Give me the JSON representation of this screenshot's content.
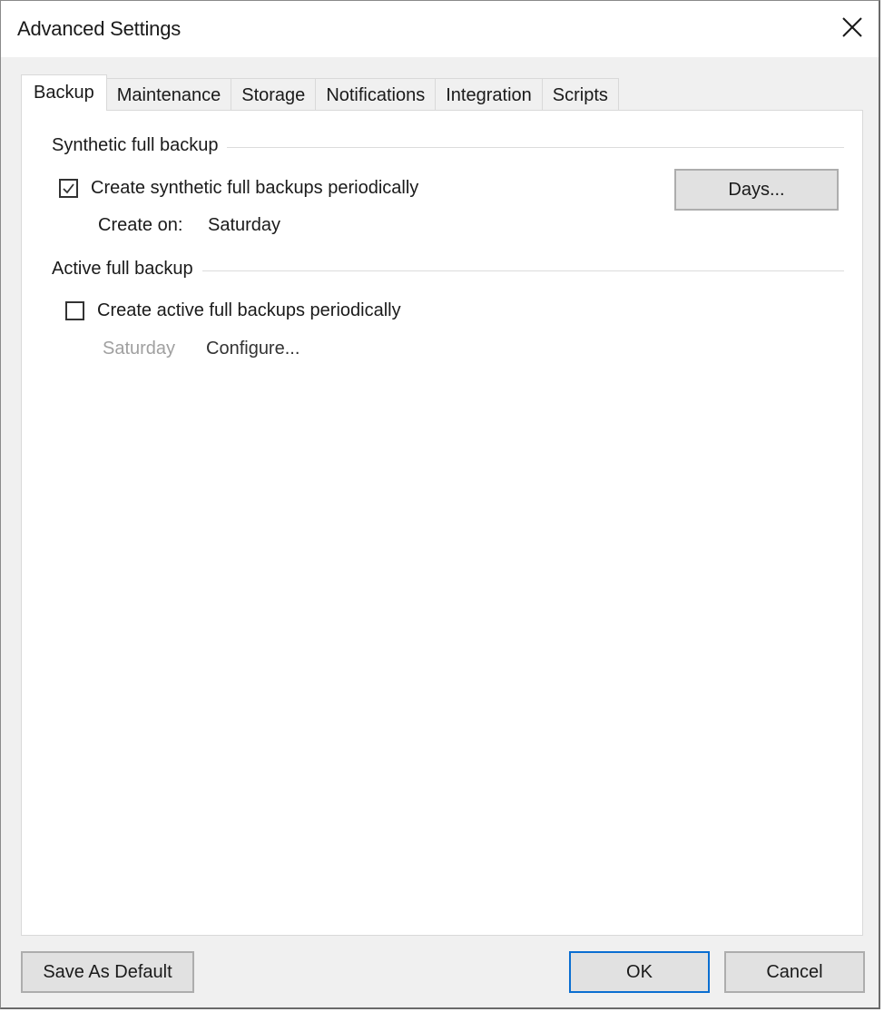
{
  "window": {
    "title": "Advanced Settings",
    "close_icon": "close-icon"
  },
  "tabs": [
    {
      "label": "Backup",
      "active": true
    },
    {
      "label": "Maintenance",
      "active": false
    },
    {
      "label": "Storage",
      "active": false
    },
    {
      "label": "Notifications",
      "active": false
    },
    {
      "label": "Integration",
      "active": false
    },
    {
      "label": "Scripts",
      "active": false
    }
  ],
  "synthetic": {
    "header": "Synthetic full backup",
    "checkbox_label": "Create synthetic full backups periodically",
    "checked": true,
    "create_on_label": "Create on:",
    "create_on_value": "Saturday",
    "days_button": "Days..."
  },
  "active": {
    "header": "Active full backup",
    "checkbox_label": "Create active full backups periodically",
    "checked": false,
    "schedule_value": "Saturday",
    "configure_link": "Configure..."
  },
  "footer": {
    "save_default": "Save As Default",
    "ok": "OK",
    "cancel": "Cancel"
  },
  "colors": {
    "default_button_border": "#0a6ed1",
    "disabled_text": "#a0a0a0"
  }
}
